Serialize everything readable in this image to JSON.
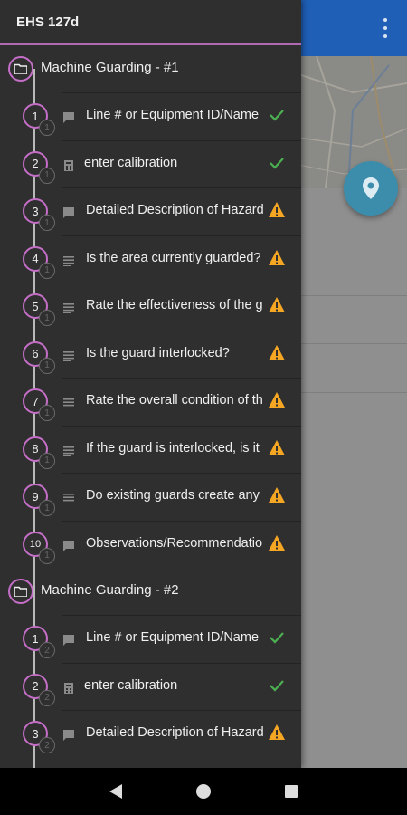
{
  "drawer": {
    "title": "EHS 127d",
    "sections": [
      {
        "label": "Machine Guarding - #1",
        "items": [
          {
            "num": "1",
            "sub": "1",
            "type": "comment",
            "label": "Line # or Equipment ID/Name",
            "status": "check"
          },
          {
            "num": "2",
            "sub": "1",
            "type": "number",
            "label": "enter calibration",
            "status": "check"
          },
          {
            "num": "3",
            "sub": "1",
            "type": "comment",
            "label": "Detailed Description of Hazard",
            "status": "warning"
          },
          {
            "num": "4",
            "sub": "1",
            "type": "list",
            "label": "Is the area currently guarded?",
            "status": "warning"
          },
          {
            "num": "5",
            "sub": "1",
            "type": "list",
            "label": "Rate the effectiveness of the guard",
            "status": "warning"
          },
          {
            "num": "6",
            "sub": "1",
            "type": "list",
            "label": "Is the guard interlocked?",
            "status": "warning"
          },
          {
            "num": "7",
            "sub": "1",
            "type": "list",
            "label": "Rate the overall condition of the guard",
            "status": "warning"
          },
          {
            "num": "8",
            "sub": "1",
            "type": "list",
            "label": "If the guard is interlocked, is it working?",
            "status": "warning"
          },
          {
            "num": "9",
            "sub": "1",
            "type": "list",
            "label": "Do existing guards create any hazards?",
            "status": "warning"
          },
          {
            "num": "10",
            "sub": "1",
            "type": "comment",
            "label": "Observations/Recommendations",
            "status": "warning"
          }
        ]
      },
      {
        "label": "Machine Guarding - #2",
        "items": [
          {
            "num": "1",
            "sub": "2",
            "type": "comment",
            "label": "Line # or Equipment ID/Name",
            "status": "check"
          },
          {
            "num": "2",
            "sub": "2",
            "type": "number",
            "label": "enter calibration",
            "status": "check"
          },
          {
            "num": "3",
            "sub": "2",
            "type": "comment",
            "label": "Detailed Description of Hazard",
            "status": "warning"
          }
        ]
      }
    ]
  },
  "colors": {
    "accent": "#c46ec7",
    "check": "#4caf50",
    "warning": "#f5a623",
    "drawer_bg": "#2f2f2f",
    "appbar": "#1f5fb6",
    "fab": "#3c8dab"
  },
  "icons": {
    "menu": "more-vert-icon",
    "fab": "location-pin-icon",
    "section": "folder-icon",
    "item_types": [
      "comment-icon",
      "number-icon",
      "list-icon"
    ],
    "status": [
      "check-icon",
      "warning-icon"
    ],
    "nav": [
      "back-icon",
      "home-icon",
      "recents-icon"
    ]
  }
}
